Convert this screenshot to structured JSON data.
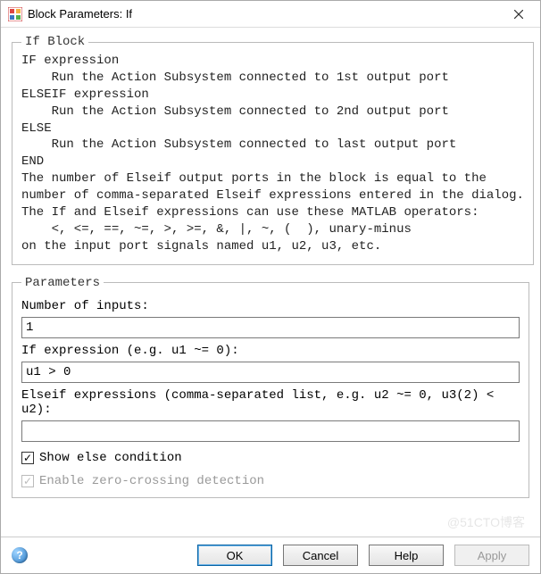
{
  "window": {
    "title": "Block Parameters: If"
  },
  "if_block": {
    "legend": "If Block",
    "lines": [
      "IF expression",
      "    Run the Action Subsystem connected to 1st output port",
      "ELSEIF expression",
      "    Run the Action Subsystem connected to 2nd output port",
      "ELSE",
      "    Run the Action Subsystem connected to last output port",
      "END",
      "The number of Elseif output ports in the block is equal to the",
      "number of comma-separated Elseif expressions entered in the dialog.",
      "The If and Elseif expressions can use these MATLAB operators:",
      "    <, <=, ==, ~=, >, >=, &, |, ~, (  ), unary-minus",
      "on the input port signals named u1, u2, u3, etc."
    ]
  },
  "parameters": {
    "legend": "Parameters",
    "num_inputs": {
      "label": "Number of inputs:",
      "value": "1"
    },
    "if_expr": {
      "label": "If expression (e.g. u1 ~= 0):",
      "value": "u1 > 0"
    },
    "elseif_expr": {
      "label": "Elseif expressions (comma-separated list, e.g. u2 ~= 0, u3(2) < u2):",
      "value": ""
    },
    "show_else": {
      "label": "Show else condition",
      "checked": true
    },
    "zero_cross": {
      "label": "Enable zero-crossing detection",
      "checked": true,
      "disabled": true
    }
  },
  "buttons": {
    "ok": "OK",
    "cancel": "Cancel",
    "help": "Help",
    "apply": "Apply"
  },
  "watermark": "@51CTO博客"
}
